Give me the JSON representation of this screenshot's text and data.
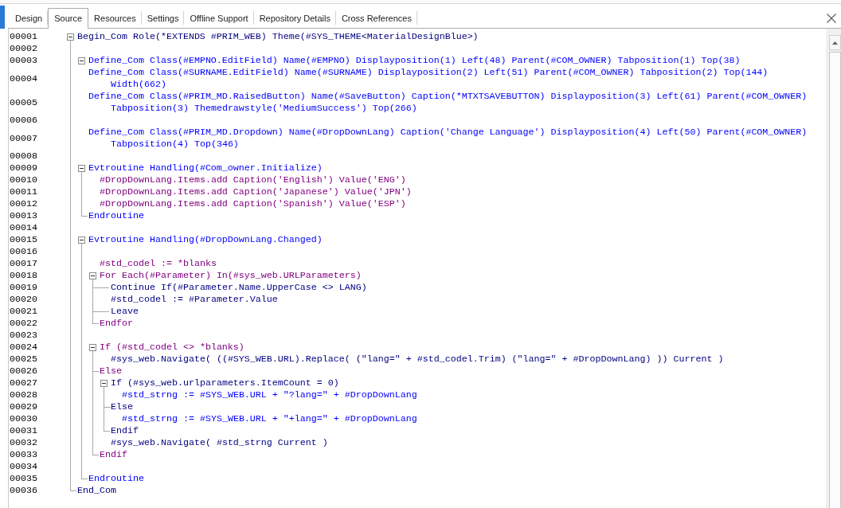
{
  "tabs": [
    {
      "label": "Design",
      "selected": false
    },
    {
      "label": "Source",
      "selected": true
    },
    {
      "label": "Resources",
      "selected": false
    },
    {
      "label": "Settings",
      "selected": false
    },
    {
      "label": "Offline Support",
      "selected": false
    },
    {
      "label": "Repository Details",
      "selected": false
    },
    {
      "label": "Cross References",
      "selected": false
    }
  ],
  "editor": {
    "lines": [
      {
        "kind": "block",
        "number": "00001",
        "text": "Begin_Com Role(*EXTENDS #PRIM_WEB) Theme(#SYS_THEME<MaterialDesignBlue>)",
        "expanded": true,
        "children": [
          {
            "kind": "blank",
            "number": "00002"
          },
          {
            "kind": "group",
            "number": "00003",
            "text": "Define_Com Class(#EMPNO.EditField) Name(#EMPNO) Displayposition(1) Left(48) Parent(#COM_OWNER) Tabposition(1) Top(38)",
            "expanded": true,
            "children": [
              {
                "kind": "statement",
                "number": "00004",
                "text": "Define_Com Class(#SURNAME.EditField) Name(#SURNAME) Displayposition(2) Left(51) Parent(#COM_OWNER) Tabposition(2) Top(144) Width(662)"
              },
              {
                "kind": "statement",
                "number": "00005",
                "text": "Define_Com Class(#PRIM_MD.RaisedButton) Name(#SaveButton) Caption(*MTXTSAVEBUTTON) Displayposition(3) Left(61) Parent(#COM_OWNER) Tabposition(3) Themedrawstyle('MediumSuccess') Top(266)"
              },
              {
                "kind": "blank",
                "number": "00006"
              },
              {
                "kind": "statement",
                "number": "00007",
                "text": "Define_Com Class(#PRIM_MD.Dropdown) Name(#DropDownLang) Caption('Change Language') Displayposition(4) Left(50) Parent(#COM_OWNER) Tabposition(4) Top(346)"
              }
            ]
          },
          {
            "kind": "blank",
            "number": "00008"
          },
          {
            "kind": "block",
            "number": "00009",
            "text": "Evtroutine Handling(#Com_owner.Initialize)",
            "expanded": true,
            "children": [
              {
                "kind": "statement",
                "number": "00010",
                "text": "#DropDownLang.Items.add Caption('English') Value('ENG')"
              },
              {
                "kind": "statement",
                "number": "00011",
                "text": "#DropDownLang.Items.add Caption('Japanese') Value('JPN')"
              },
              {
                "kind": "statement",
                "number": "00012",
                "text": "#DropDownLang.Items.add Caption('Spanish') Value('ESP')"
              }
            ],
            "close": {
              "number": "00013",
              "text": "Endroutine"
            }
          },
          {
            "kind": "blank",
            "number": "00014"
          },
          {
            "kind": "block",
            "number": "00015",
            "text": "Evtroutine Handling(#DropDownLang.Changed)",
            "expanded": true,
            "children": [
              {
                "kind": "blank",
                "number": "00016"
              },
              {
                "kind": "statement",
                "number": "00017",
                "text": "#std_codel := *blanks"
              },
              {
                "kind": "block",
                "number": "00018",
                "text": "For Each(#Parameter) In(#sys_web.URLParameters)",
                "expanded": true,
                "children": [
                  {
                    "kind": "jump",
                    "number": "00019",
                    "text": "Continue If(#Parameter.Name.UpperCase <> LANG)"
                  },
                  {
                    "kind": "statement",
                    "number": "00020",
                    "text": "#std_codel := #Parameter.Value"
                  },
                  {
                    "kind": "jump",
                    "number": "00021",
                    "text": "Leave"
                  }
                ],
                "close": {
                  "number": "00022",
                  "text": "Endfor"
                }
              },
              {
                "kind": "blank",
                "number": "00023"
              },
              {
                "kind": "block",
                "number": "00024",
                "text": "If (#std_codel <> *blanks)",
                "expanded": true,
                "children": [
                  {
                    "kind": "statement",
                    "number": "00025",
                    "text": "#sys_web.Navigate( ((#SYS_WEB.URL).Replace( (\"lang=\" + #std_codel.Trim) (\"lang=\" + #DropDownLang) )) Current )"
                  },
                  {
                    "kind": "branch",
                    "number": "00026",
                    "text": "Else"
                  },
                  {
                    "kind": "block",
                    "number": "00027",
                    "text": "If (#sys_web.urlparameters.ItemCount = 0)",
                    "expanded": true,
                    "children": [
                      {
                        "kind": "statement",
                        "number": "00028",
                        "text": "#std_strng := #SYS_WEB.URL + \"?lang=\" + #DropDownLang"
                      },
                      {
                        "kind": "branch",
                        "number": "00029",
                        "text": "Else"
                      },
                      {
                        "kind": "statement",
                        "number": "00030",
                        "text": "#std_strng := #SYS_WEB.URL + \"+lang=\" + #DropDownLang"
                      }
                    ],
                    "close": {
                      "number": "00031",
                      "text": "Endif"
                    }
                  },
                  {
                    "kind": "statement",
                    "number": "00032",
                    "text": "#sys_web.Navigate( #std_strng Current )"
                  }
                ],
                "close": {
                  "number": "00033",
                  "text": "Endif"
                }
              },
              {
                "kind": "blank",
                "number": "00034"
              }
            ],
            "close": {
              "number": "00035",
              "text": "Endroutine"
            }
          }
        ],
        "close": {
          "number": "00036",
          "text": "End_Com"
        }
      }
    ]
  }
}
